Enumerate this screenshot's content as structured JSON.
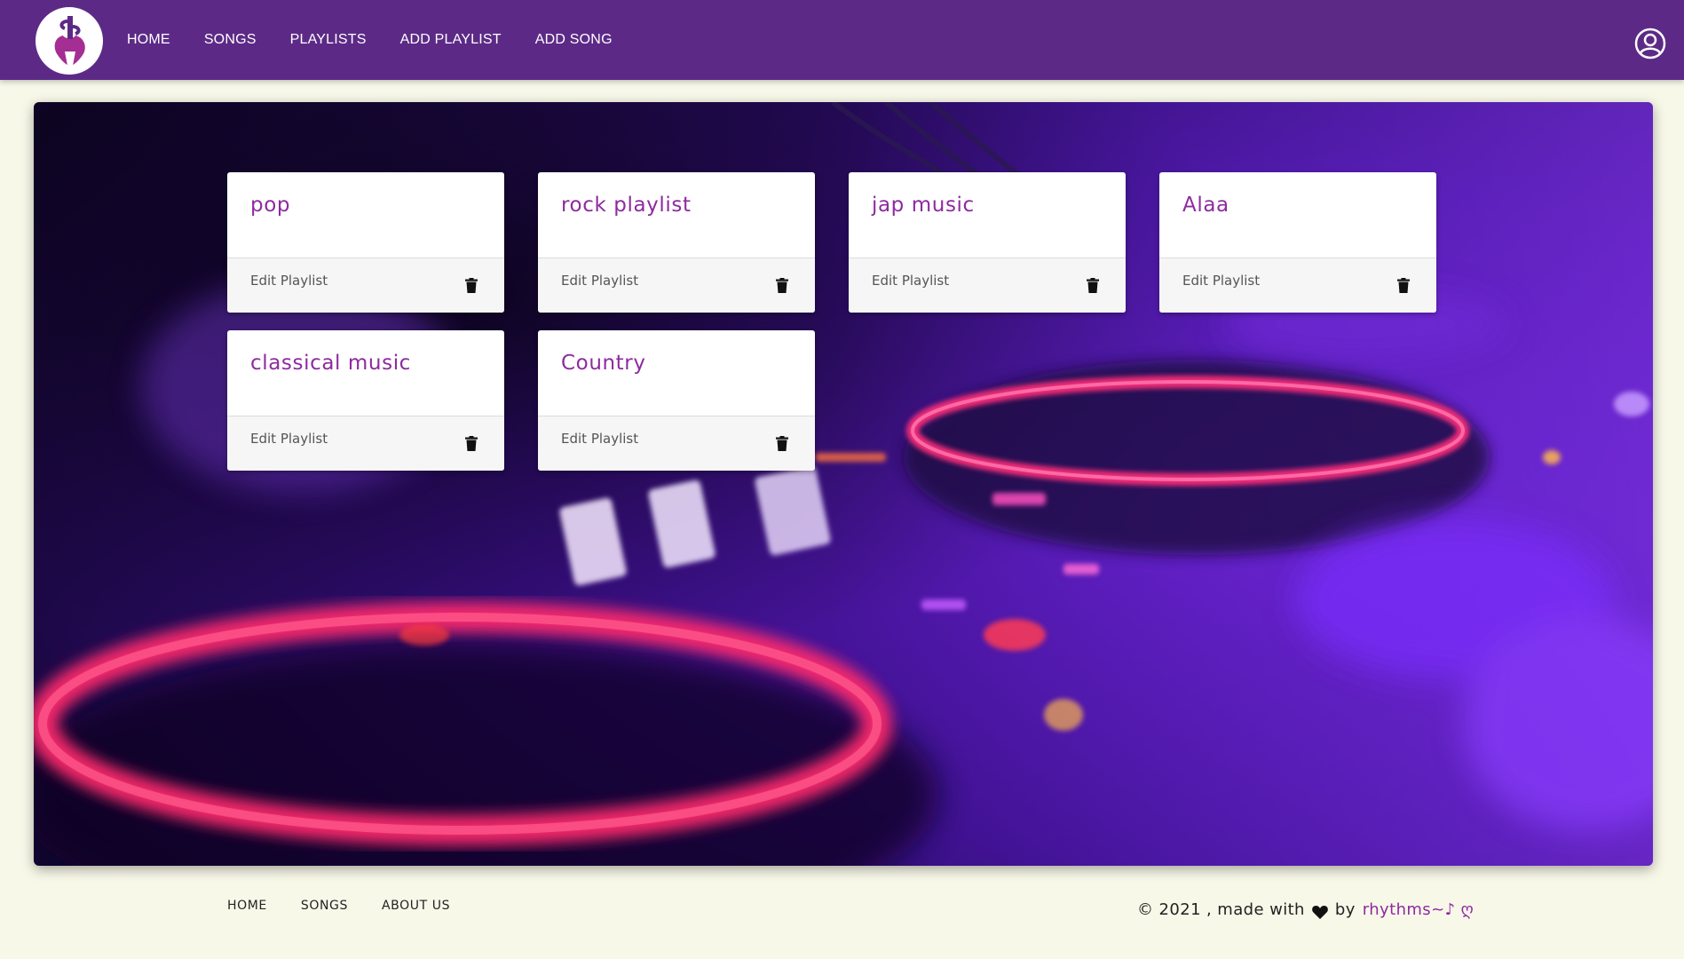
{
  "navbar": {
    "logo_icon": "guitar-logo-icon",
    "links": [
      "HOME",
      "SONGS",
      "PLAYLISTS",
      "ADD PLAYLIST",
      "ADD SONG"
    ],
    "profile_icon": "user-circle-icon"
  },
  "playlists": [
    {
      "name": "pop",
      "edit_label": "Edit Playlist"
    },
    {
      "name": "rock playlist",
      "edit_label": "Edit Playlist"
    },
    {
      "name": "jap music",
      "edit_label": "Edit Playlist"
    },
    {
      "name": "Alaa",
      "edit_label": "Edit Playlist"
    },
    {
      "name": "classical music",
      "edit_label": "Edit Playlist"
    },
    {
      "name": "Country",
      "edit_label": "Edit Playlist"
    }
  ],
  "footer": {
    "links": [
      "HOME",
      "SONGS",
      "ABOUT US"
    ],
    "copyright_prefix": "© 2021 , made with",
    "copyright_by": "by",
    "brand": "rhythms~♪ ღ"
  },
  "colors": {
    "navbar": "#5c2a86",
    "accent": "#8e2aa0",
    "page_bg": "#f8f8e9"
  }
}
